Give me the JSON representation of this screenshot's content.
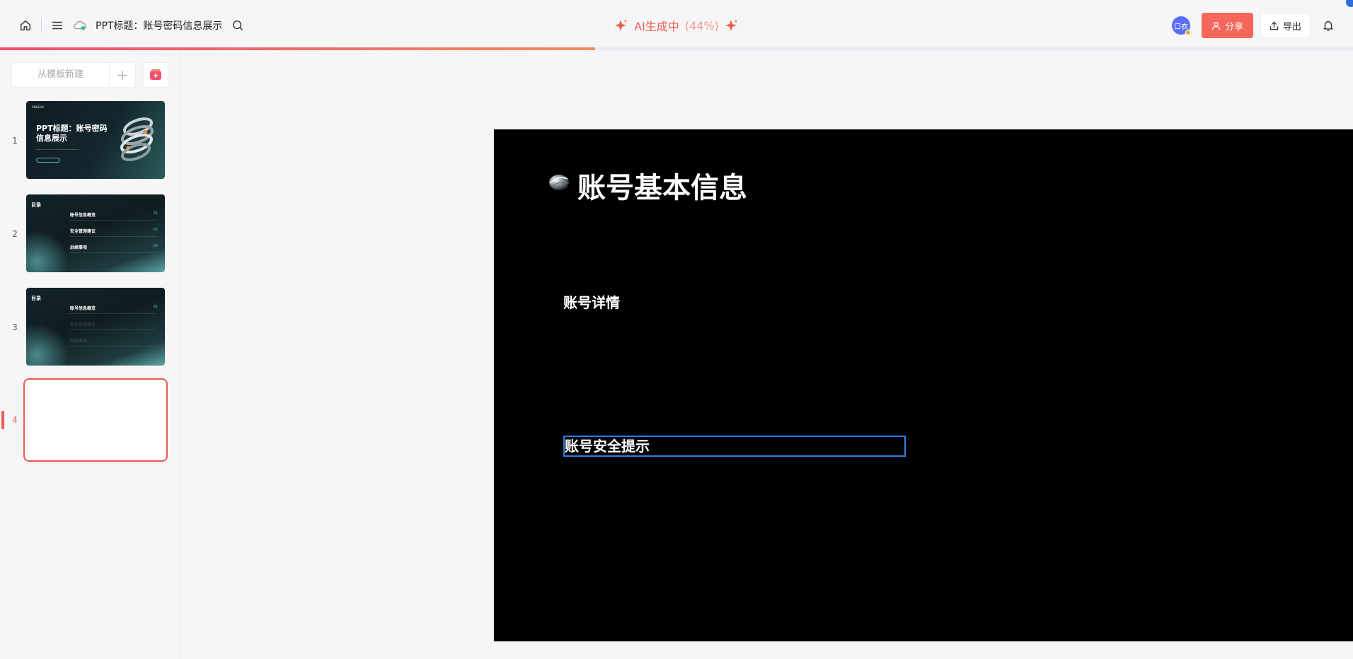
{
  "header": {
    "doc_title": "PPT标题：账号密码信息展示",
    "ai_status_label": "AI生成中",
    "ai_status_percent": "(44%)",
    "progress": 0.44,
    "avatar_text": "口衣",
    "share_label": "分享",
    "export_label": "导出"
  },
  "sidebar": {
    "new_from_template": "从模板新建",
    "add_symbol": "+",
    "slides": [
      {
        "number": "1",
        "title": "PPT标题：账号密码信息展示"
      },
      {
        "number": "2",
        "heading": "目录",
        "items": [
          "账号信息概览",
          "安全管理建议",
          "后续事项"
        ],
        "item_numbers": [
          "01",
          "02",
          "03"
        ]
      },
      {
        "number": "3",
        "heading": "目录",
        "items": [
          "账号信息概览",
          "安全管理建议",
          "后续事项"
        ],
        "item_numbers": [
          "01"
        ]
      },
      {
        "number": "4"
      }
    ]
  },
  "slide": {
    "title": "账号基本信息",
    "section_1": "账号详情",
    "section_2": "账号安全提示"
  },
  "colors": {
    "accent": "#f05a4f",
    "share_bg": "#f5675a",
    "selection_border": "#2f7de1",
    "avatar_bg": "#5b6ef5"
  }
}
